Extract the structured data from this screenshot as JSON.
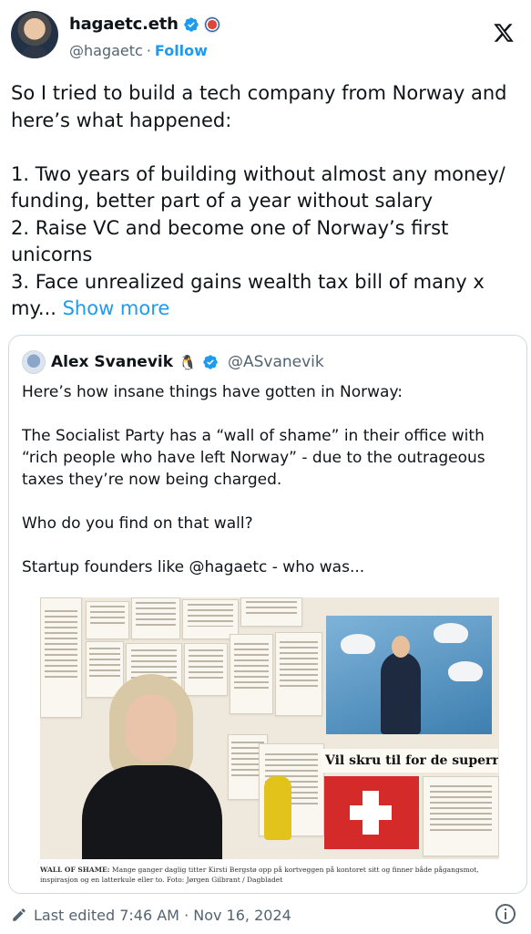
{
  "author": {
    "display_name": "hagaetc.eth",
    "handle": "@hagaetc",
    "separator": "·",
    "follow_label": "Follow"
  },
  "tweet": {
    "text": "So I tried to build a tech company from Norway and here’s what happened:\n\n1. Two years of building without almost any money/ funding, better part of a year without salary\n2. Raise VC and become one of Norway’s first unicorns\n3. Face unrealized gains wealth tax bill of many x my... ",
    "show_more": "Show more"
  },
  "quoted": {
    "display_name": "Alex Svanevik",
    "emoji": "🐧",
    "handle": "@ASvanevik",
    "text": "Here’s how insane things have gotten in Norway:\n\nThe Socialist Party has a “wall of shame” in their office with “rich people who have left Norway” - due to the outrageous taxes they’re now being charged.\n\nWho do you find on that wall?\n\nStartup founders like @hagaetc - who was...",
    "photo": {
      "clip_headline_1": "– En giftig cocktail av skatt",
      "clip_headline_2": "Vil skru til for de superrike i Sveits",
      "caption_lead": "WALL OF SHAME:",
      "caption_text": " Mange ganger daglig titter Kirsti Bergstø opp på kortveggen på kontoret sitt og finner både pågangsmot, inspirasjon og en latterkule eller to. Foto: Jørgen Gilbrant / Dagbladet"
    }
  },
  "footer": {
    "edited": "Last edited 7:46 AM · Nov 16, 2024"
  },
  "colors": {
    "accent": "#1d9bf0",
    "muted": "#536471",
    "text": "#0f1419",
    "border": "#cfd9de"
  },
  "icons": [
    "verified-badge-icon",
    "x-logo-icon",
    "pencil-icon",
    "info-icon"
  ]
}
